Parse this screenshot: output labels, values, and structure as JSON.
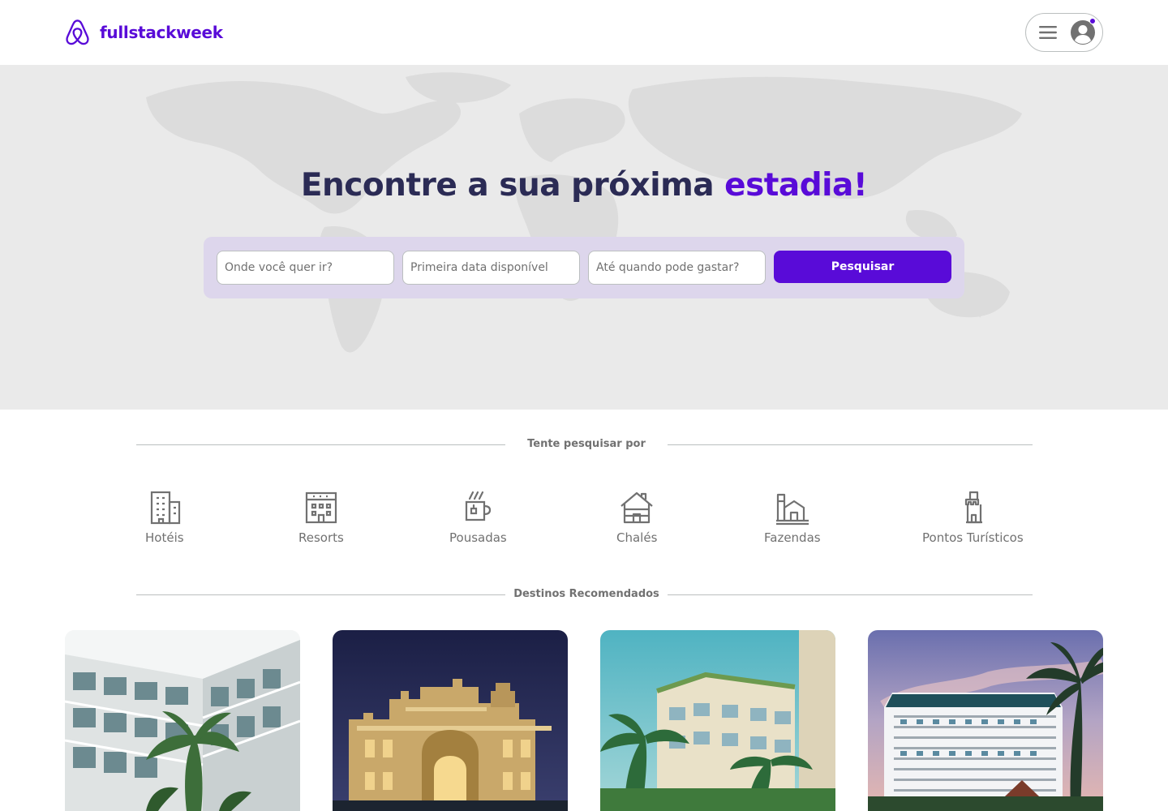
{
  "header": {
    "brand": "fullstackweek",
    "brand_color": "#590bd8",
    "menu_icon": "hamburger-icon",
    "avatar_icon": "user-avatar-icon"
  },
  "hero": {
    "title_main": "Encontre a sua próxima ",
    "title_accent": "estadia!",
    "search": {
      "destination_placeholder": "Onde você quer ir?",
      "date_placeholder": "Primeira data disponível",
      "budget_placeholder": "Até quando pode gastar?",
      "button_label": "Pesquisar"
    }
  },
  "sections": {
    "quick_search_label": "Tente pesquisar por",
    "recommended_label": "Destinos Recomendados"
  },
  "categories": [
    {
      "label": "Hotéis",
      "icon": "hotel-building-icon"
    },
    {
      "label": "Resorts",
      "icon": "resort-building-icon"
    },
    {
      "label": "Pousadas",
      "icon": "coffee-mug-icon"
    },
    {
      "label": "Chalés",
      "icon": "chalet-house-icon"
    },
    {
      "label": "Fazendas",
      "icon": "farm-icon"
    },
    {
      "label": "Pontos Turísticos",
      "icon": "tower-landmark-icon"
    }
  ],
  "destinations": [
    {
      "image": "modern-hotel-courtyard-photo"
    },
    {
      "image": "illuminated-palace-night-photo"
    },
    {
      "image": "resort-with-palm-trees-photo"
    },
    {
      "image": "beachfront-tower-sunset-photo"
    }
  ],
  "colors": {
    "primary": "#590bd8",
    "title_dark": "#2b2b55",
    "text_gray": "#717171",
    "border": "#bbbfbf",
    "hero_bg": "#eaeaea",
    "search_box_bg": "#ddd6ec"
  }
}
